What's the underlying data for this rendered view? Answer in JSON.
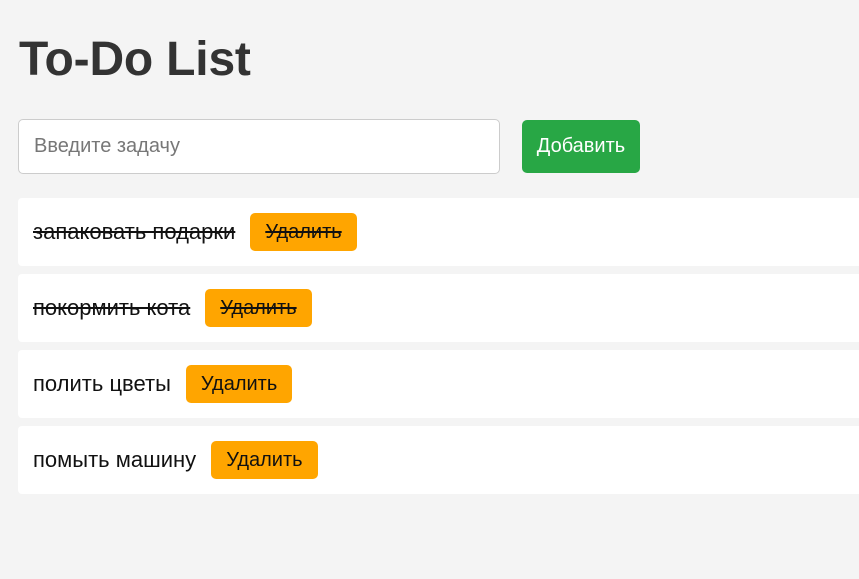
{
  "header": {
    "title": "To-Do List"
  },
  "add_form": {
    "input_value": "",
    "input_placeholder": "Введите задачу",
    "add_button_label": "Добавить"
  },
  "colors": {
    "background": "#f4f4f4",
    "add_button": "#28a745",
    "delete_button": "#ffa500",
    "title_text": "#333333"
  },
  "tasks": [
    {
      "text": "запаковать подарки",
      "completed": true,
      "delete_label": "Удалить"
    },
    {
      "text": "покормить кота",
      "completed": true,
      "delete_label": "Удалить"
    },
    {
      "text": "полить цветы",
      "completed": false,
      "delete_label": "Удалить"
    },
    {
      "text": "помыть машину",
      "completed": false,
      "delete_label": "Удалить"
    }
  ]
}
